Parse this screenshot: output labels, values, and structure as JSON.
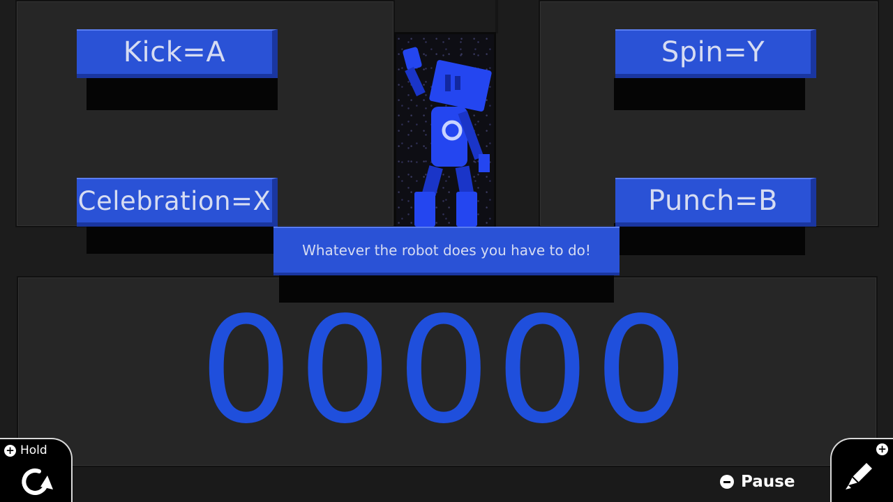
{
  "controls": {
    "kick_label": "Kick=A",
    "spin_label": "Spin=Y",
    "celebration_label": "Celebration=X",
    "punch_label": "Punch=B"
  },
  "message": "Whatever the robot does you have to do!",
  "score": "00000",
  "hud": {
    "hold_label": "Hold",
    "pause_label": "Pause"
  },
  "icons": {
    "hold": "rotate-arrow-icon",
    "edit": "pencil-icon",
    "add": "plus-icon",
    "pause": "minus-icon"
  },
  "colors": {
    "button_blue": "#2a52d6",
    "score_blue": "#1f4fdc",
    "robot_blue": "#1f3fe6",
    "background": "#1c1c1c"
  }
}
